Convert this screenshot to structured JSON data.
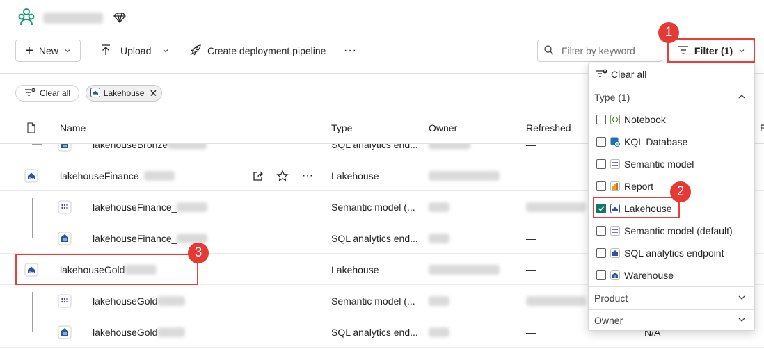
{
  "header": {
    "workspace_logo": "workspace-icon",
    "premium_icon": "diamond-icon"
  },
  "toolbar": {
    "new_label": "New",
    "upload_label": "Upload",
    "pipeline_label": "Create deployment pipeline",
    "more_label": "···",
    "search_placeholder": "Filter by keyword",
    "filter_label": "Filter (1)"
  },
  "chips": {
    "clear_label": "Clear all",
    "lakehouse_label": "Lakehouse"
  },
  "table": {
    "headers": {
      "name": "Name",
      "type": "Type",
      "owner": "Owner",
      "refreshed": "Refreshed",
      "extra": "E"
    },
    "rows": [
      {
        "name": "lakehouseBronze",
        "type": "SQL analytics end...",
        "refreshed": "—"
      },
      {
        "name": "lakehouseFinance_",
        "type": "Lakehouse",
        "refreshed": "—"
      },
      {
        "name": "lakehouseFinance_",
        "type": "Semantic model (...",
        "refreshed": ""
      },
      {
        "name": "lakehouseFinance_",
        "type": "SQL analytics end...",
        "refreshed": "—"
      },
      {
        "name": "lakehouseGold",
        "type": "Lakehouse",
        "refreshed": "—"
      },
      {
        "name": "lakehouseGold",
        "type": "Semantic model (...",
        "refreshed": ""
      },
      {
        "name": "lakehouseGold",
        "type": "SQL analytics end...",
        "refreshed": "—"
      }
    ],
    "extra_value": "N/A"
  },
  "filter_panel": {
    "clear_all": "Clear all",
    "type_section": "Type (1)",
    "options": [
      {
        "label": "Notebook",
        "icon": "notebook-icon",
        "checked": false
      },
      {
        "label": "KQL Database",
        "icon": "kql-database-icon",
        "checked": false
      },
      {
        "label": "Semantic model",
        "icon": "semantic-model-icon",
        "checked": false
      },
      {
        "label": "Report",
        "icon": "report-icon",
        "checked": false
      },
      {
        "label": "Lakehouse",
        "icon": "lakehouse-icon",
        "checked": true
      },
      {
        "label": "Semantic model (default)",
        "icon": "semantic-model-icon",
        "checked": false
      },
      {
        "label": "SQL analytics endpoint",
        "icon": "sql-endpoint-icon",
        "checked": false
      },
      {
        "label": "Warehouse",
        "icon": "warehouse-icon",
        "checked": false
      }
    ],
    "product_section": "Product",
    "owner_section": "Owner"
  },
  "annotations": {
    "badge1": "1",
    "badge2": "2",
    "badge3": "3"
  },
  "colors": {
    "accent": "#117865",
    "highlight": "#e5403a",
    "badge": "#e53935",
    "item_blue": "#2b579a"
  }
}
